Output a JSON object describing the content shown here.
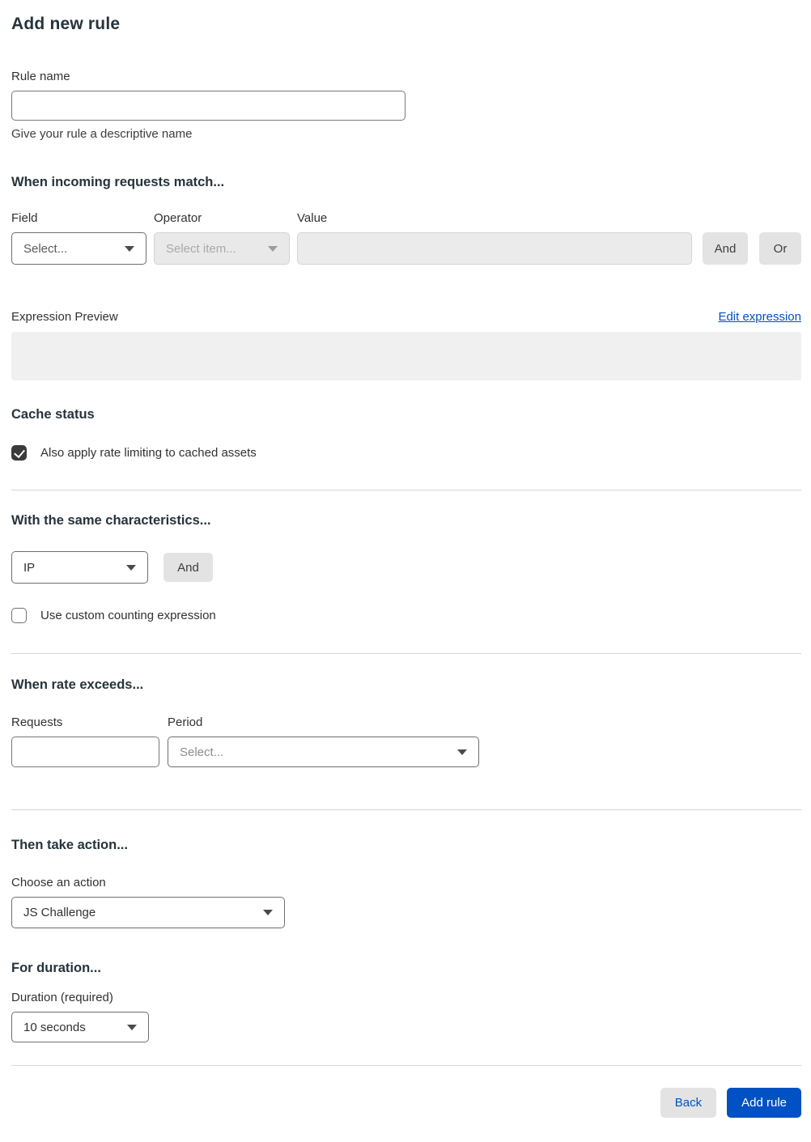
{
  "page": {
    "title": "Add new rule"
  },
  "rule_name": {
    "label": "Rule name",
    "value": "",
    "help": "Give your rule a descriptive name"
  },
  "match": {
    "heading": "When incoming requests match...",
    "field": {
      "label": "Field",
      "selected": "Select..."
    },
    "operator": {
      "label": "Operator",
      "selected": "Select item..."
    },
    "value": {
      "label": "Value",
      "value": ""
    },
    "and_label": "And",
    "or_label": "Or",
    "expression_preview_label": "Expression Preview",
    "edit_expression_label": "Edit expression",
    "expression_value": ""
  },
  "cache_status": {
    "heading": "Cache status",
    "checkbox_label": "Also apply rate limiting to cached assets",
    "checked": true
  },
  "characteristics": {
    "heading": "With the same characteristics...",
    "select_selected": "IP",
    "and_label": "And",
    "checkbox_label": "Use custom counting expression",
    "checked": false
  },
  "rate": {
    "heading": "When rate exceeds...",
    "requests": {
      "label": "Requests",
      "value": ""
    },
    "period": {
      "label": "Period",
      "selected": "Select..."
    }
  },
  "action": {
    "heading": "Then take action...",
    "label": "Choose an action",
    "selected": "JS Challenge"
  },
  "duration": {
    "heading": "For duration...",
    "label": "Duration (required)",
    "selected": "10 seconds"
  },
  "footer": {
    "back_label": "Back",
    "submit_label": "Add rule"
  },
  "colors": {
    "accent_blue": "#0051c3",
    "checkbox_checked": "#3a3a3a",
    "disabled_bg": "#e9e9e9",
    "grey_button_bg": "#e3e3e3",
    "divider": "#d6d6d6",
    "expression_box_bg": "#f0f0f0"
  }
}
